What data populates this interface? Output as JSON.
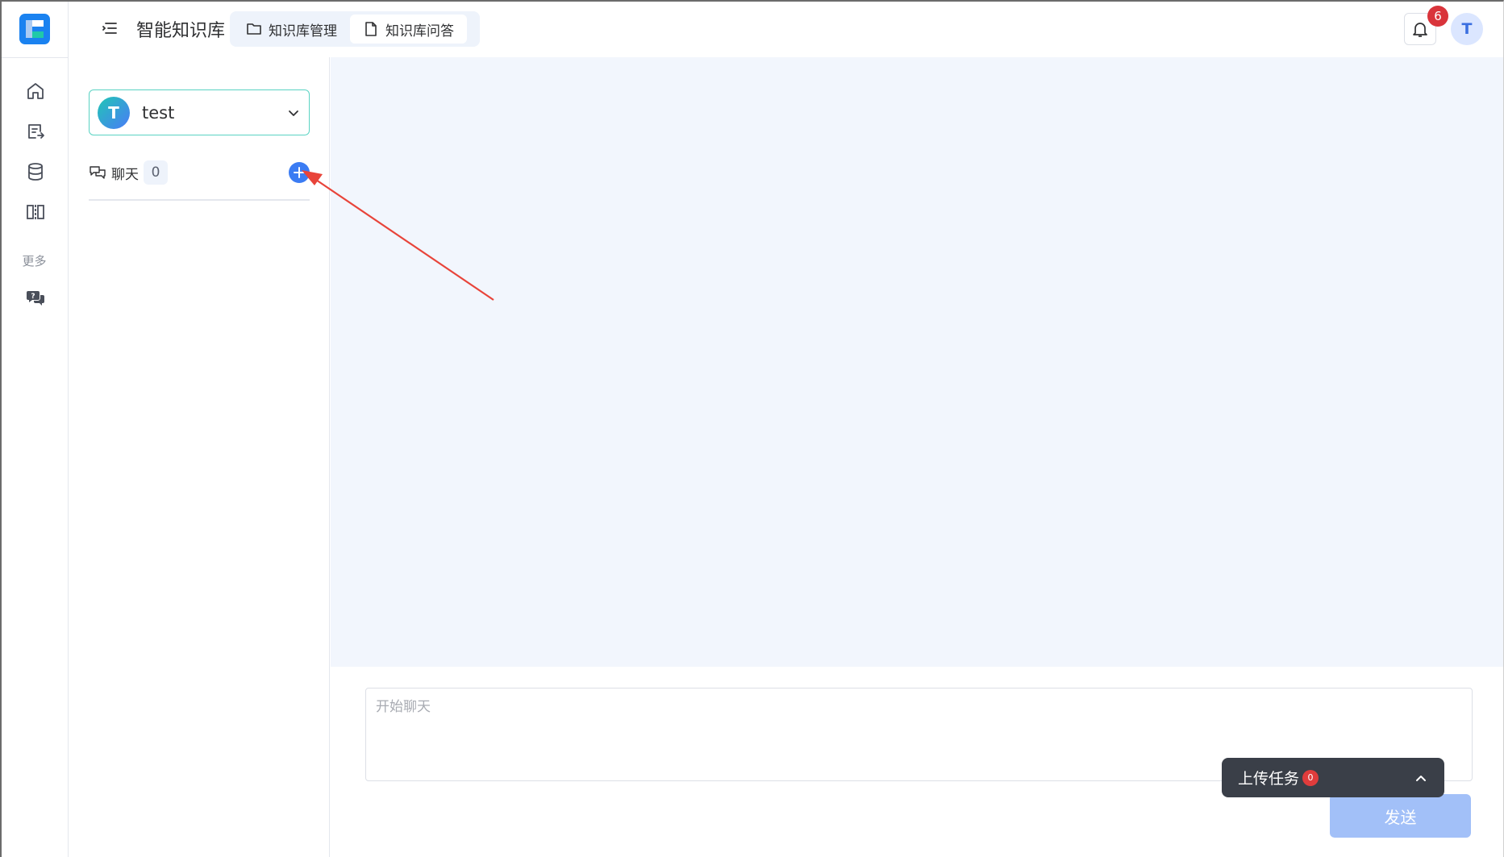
{
  "header": {
    "app_title": "智能知识库",
    "tabs": [
      {
        "label": "知识库管理",
        "icon": "folder-icon"
      },
      {
        "label": "知识库问答",
        "icon": "document-icon"
      }
    ],
    "notification_count": "6",
    "user_initial": "T"
  },
  "rail": {
    "items": [
      {
        "name": "home-icon"
      },
      {
        "name": "document-export-icon"
      },
      {
        "name": "database-icon"
      },
      {
        "name": "columns-icon"
      }
    ],
    "more_label": "更多",
    "more_items": [
      {
        "name": "question-chat-icon"
      }
    ]
  },
  "side_panel": {
    "knowledge_base": {
      "initial": "T",
      "name": "test"
    },
    "chat": {
      "label": "聊天",
      "count": "0"
    }
  },
  "composer": {
    "placeholder": "开始聊天",
    "send_label": "发送"
  },
  "upload_task": {
    "label": "上传任务",
    "count": "0"
  },
  "colors": {
    "accent": "#3b7cf3",
    "main_bg": "#f2f6fd",
    "badge_red": "#d9343b",
    "annotation_red": "#e8443a",
    "teal_border": "#5ad3c3"
  }
}
